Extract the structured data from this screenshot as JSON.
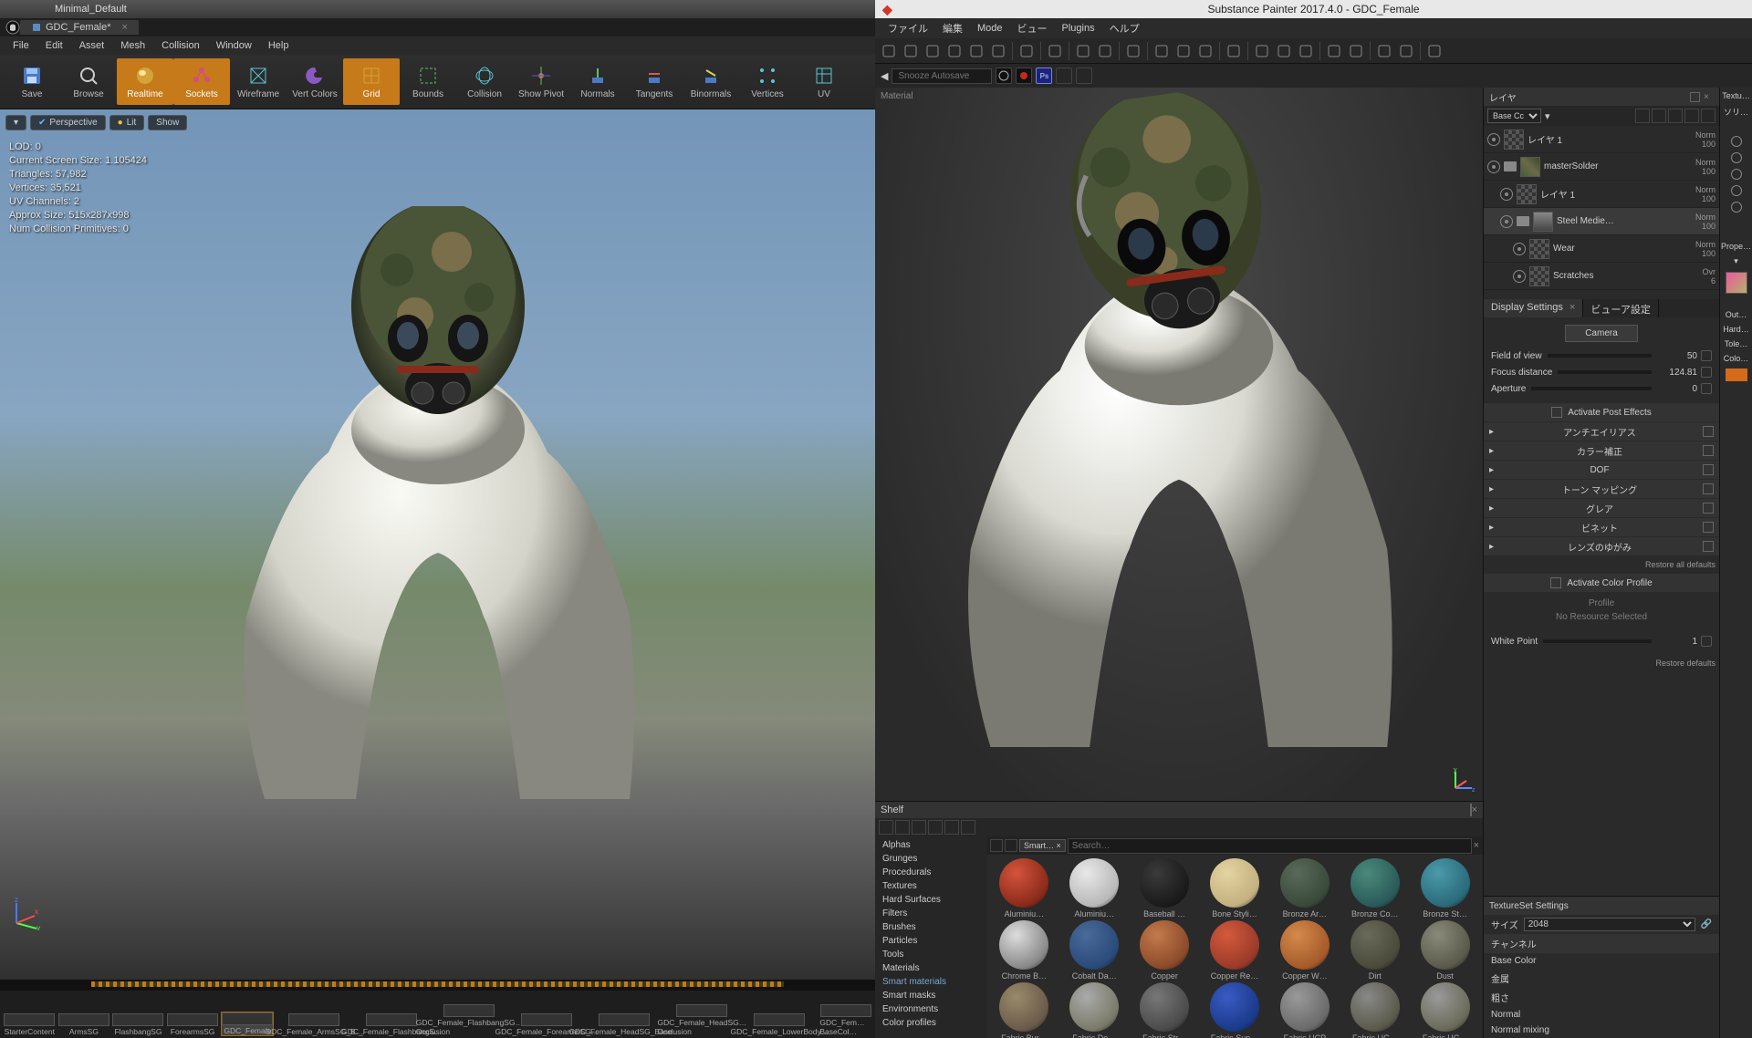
{
  "ue": {
    "title_left": "Minimal_Default",
    "tab": "GDC_Female*",
    "menu": [
      "File",
      "Edit",
      "Asset",
      "Mesh",
      "Collision",
      "Window",
      "Help"
    ],
    "tools": [
      {
        "label": "Save",
        "kind": "disk"
      },
      {
        "label": "Browse",
        "kind": "lens"
      },
      {
        "label": "Realtime",
        "kind": "sphere",
        "active": true
      },
      {
        "label": "Sockets",
        "kind": "socket",
        "active": true
      },
      {
        "label": "Wireframe",
        "kind": "wire"
      },
      {
        "label": "Vert Colors",
        "kind": "palette"
      },
      {
        "label": "Grid",
        "kind": "grid",
        "active": true
      },
      {
        "label": "Bounds",
        "kind": "bounds"
      },
      {
        "label": "Collision",
        "kind": "coll"
      },
      {
        "label": "Show Pivot",
        "kind": "pivot"
      },
      {
        "label": "Normals",
        "kind": "norm"
      },
      {
        "label": "Tangents",
        "kind": "tang"
      },
      {
        "label": "Binormals",
        "kind": "binorm"
      },
      {
        "label": "Vertices",
        "kind": "verts"
      },
      {
        "label": "UV",
        "kind": "uv"
      }
    ],
    "viewport_buttons": [
      "Perspective",
      "Lit",
      "Show"
    ],
    "stats": [
      "LOD:  0",
      "Current Screen Size:  1.105424",
      "Triangles:  57,982",
      "Vertices:  35,521",
      "UV Channels:  2",
      "Approx Size:  515x287x998",
      "Num Collision Primitives:  0"
    ],
    "slots": [
      "StarterContent",
      "ArmsSG",
      "FlashbangSG",
      "ForearmsSG",
      "GDC_Female",
      "GDC_Female_ArmsSG_B…",
      "GDC_Female_FlashbangS…",
      "GDC_Female_FlashbangSG…Occlusion",
      "GDC_Female_ForearmsSG…",
      "GDC_Female_HeadSG_Base…",
      "GDC_Female_HeadSG…Occlusion",
      "GDC_Female_LowerBody…",
      "GDC_Fem…BaseCol…"
    ]
  },
  "sp": {
    "title": "Substance Painter 2017.4.0 - GDC_Female",
    "menu": [
      "ファイル",
      "編集",
      "Mode",
      "ビュー",
      "Plugins",
      "ヘルプ"
    ],
    "autosave_placeholder": "Snooze Autosave",
    "viewport_label": "Material",
    "layers_title": "レイヤ",
    "blend_mode": "Base Cc",
    "layers": [
      {
        "name": "レイヤ 1",
        "mode": "Norm",
        "op": "100",
        "swatch": "checker"
      },
      {
        "name": "masterSolder",
        "mode": "Norm",
        "op": "100",
        "swatch": "camo",
        "folder": true
      },
      {
        "name": "レイヤ 1",
        "mode": "Norm",
        "op": "100",
        "swatch": "checker",
        "indent": 1
      },
      {
        "name": "Steel Medie…",
        "mode": "Norm",
        "op": "100",
        "swatch": "steel",
        "folder": true,
        "indent": 1,
        "sel": true
      },
      {
        "name": "Wear",
        "mode": "Norm",
        "op": "100",
        "swatch": "checker",
        "indent": 2
      },
      {
        "name": "Scratches",
        "mode": "Ovr",
        "op": "6",
        "swatch": "checker",
        "indent": 2
      }
    ],
    "display_tabs": [
      "Display Settings",
      "ビューア設定"
    ],
    "camera_label": "Camera",
    "camera": [
      {
        "label": "Field of view",
        "value": "50"
      },
      {
        "label": "Focus distance",
        "value": "124.81"
      },
      {
        "label": "Aperture",
        "value": "0"
      }
    ],
    "post_effects_btn": "Activate Post Effects",
    "collapsibles": [
      "アンチエイリアス",
      "カラー補正",
      "DOF",
      "トーン マッピング",
      "グレア",
      "ビネット",
      "レンズのゆがみ"
    ],
    "restore_defaults": "Restore all defaults",
    "color_profile_btn": "Activate Color Profile",
    "profile_label": "Profile",
    "no_resource": "No Resource Selected",
    "white_point": {
      "label": "White Point",
      "value": "1"
    },
    "restore_defaults2": "Restore defaults",
    "texset_title": "TextureSet Settings",
    "texset_size_label": "サイズ",
    "texset_size": "2048",
    "channel_label": "チャンネル",
    "channels": [
      "Base Color",
      "金属",
      "粗さ",
      "Normal",
      "Normal mixing"
    ],
    "right_edge": [
      "Textu…",
      "ソリ…",
      "Out…",
      "Hard…",
      "Tole…",
      "Colo…"
    ],
    "prop_label": "Prope…",
    "shelf_title": "Shelf",
    "shelf_cats": [
      "Alphas",
      "Grunges",
      "Procedurals",
      "Textures",
      "Hard Surfaces",
      "Filters",
      "Brushes",
      "Particles",
      "Tools",
      "Materials",
      "Smart materials",
      "Smart masks",
      "Environments",
      "Color profiles"
    ],
    "shelf_active_cat": "Smart materials",
    "shelf_tag": "Smart…",
    "shelf_search_placeholder": "Search…",
    "materials": [
      {
        "name": "Aluminiu…",
        "c1": "#8a2a1a",
        "c2": "#d4543a"
      },
      {
        "name": "Aluminiu…",
        "c1": "#b8b8b8",
        "c2": "#e8e8e8"
      },
      {
        "name": "Baseball …",
        "c1": "#1a1a1a",
        "c2": "#3a3a3a"
      },
      {
        "name": "Bone Styli…",
        "c1": "#c4b080",
        "c2": "#e4d4a0"
      },
      {
        "name": "Bronze Ar…",
        "c1": "#3a4a3a",
        "c2": "#5a6a5a"
      },
      {
        "name": "Bronze Co…",
        "c1": "#2a5a5a",
        "c2": "#4a8a7a"
      },
      {
        "name": "Bronze St…",
        "c1": "#2a6a7a",
        "c2": "#4a9aaa"
      },
      {
        "name": "Chrome B…",
        "c1": "#888",
        "c2": "#ddd"
      },
      {
        "name": "Cobalt Da…",
        "c1": "#2a4a7a",
        "c2": "#4a6a9a"
      },
      {
        "name": "Copper",
        "c1": "#8a4a2a",
        "c2": "#c47a4a"
      },
      {
        "name": "Copper Re…",
        "c1": "#9a3a2a",
        "c2": "#d45a3a"
      },
      {
        "name": "Copper W…",
        "c1": "#a45a2a",
        "c2": "#d48a4a"
      },
      {
        "name": "Dirt",
        "c1": "#4a4a3a",
        "c2": "#6a6a5a"
      },
      {
        "name": "Dust",
        "c1": "#5a5a4a",
        "c2": "#8a8a7a"
      },
      {
        "name": "Fabric Bur…",
        "c1": "#6a5a4a",
        "c2": "#9a8a6a"
      },
      {
        "name": "Fabric Do…",
        "c1": "#7a7a6a",
        "c2": "#aaa"
      },
      {
        "name": "Fabric Str…",
        "c1": "#4a4a4a",
        "c2": "#777"
      },
      {
        "name": "Fabric Sup…",
        "c1": "#1a3a8a",
        "c2": "#3a5ac4"
      },
      {
        "name": "Fabric UCP",
        "c1": "#6a6a6a",
        "c2": "#999"
      },
      {
        "name": "Fabric UC…",
        "c1": "#5a5a4a",
        "c2": "#888"
      },
      {
        "name": "Fabric UC…",
        "c1": "#6a6a5a",
        "c2": "#999"
      }
    ]
  }
}
